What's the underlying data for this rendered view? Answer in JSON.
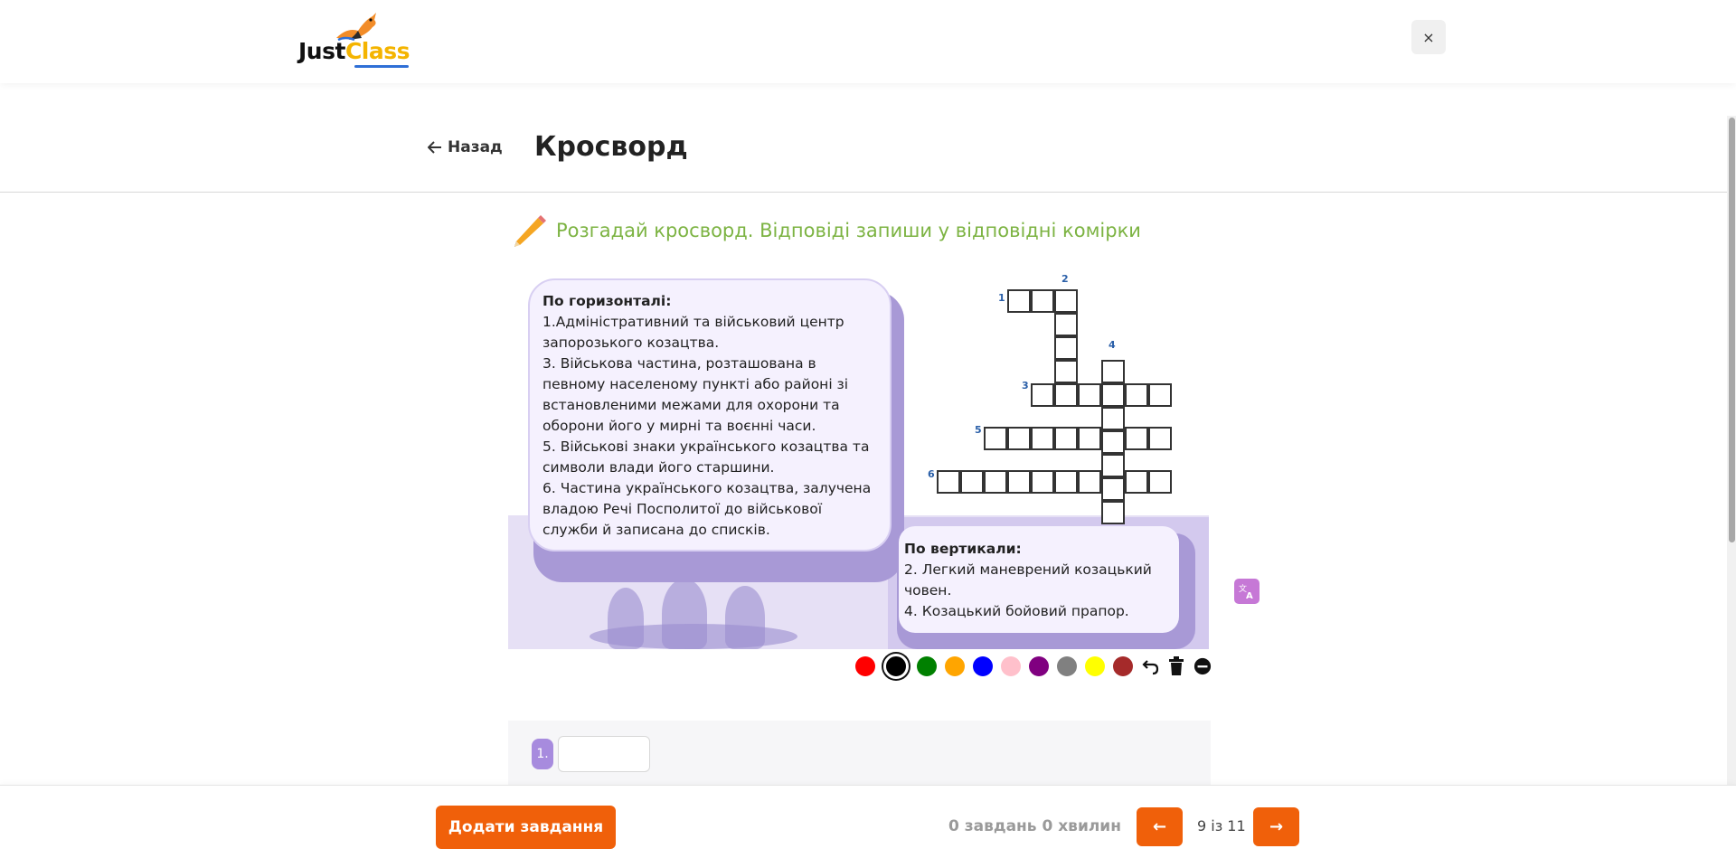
{
  "header": {
    "logo_just": "Just",
    "logo_class": "Class",
    "close_label": "×"
  },
  "page": {
    "back_label": "Назад",
    "title": "Кросворд"
  },
  "task": {
    "instruction": "Розгадай кросворд. Відповіді запиши у відповідні комірки",
    "horizontal_heading": "По горизонталі:",
    "horizontal_clues": [
      "1.Адміністративний та військовий центр запорозького козацтва.",
      "3. Військова частина, розташована в певному населеному пункті або районі зі встановленими межами для охорони та оборони його у мирні та воєнні часи.",
      " 5. Військові знаки українського козацтва та символи влади його старшини.",
      "6. Частина українського козацтва, залучена владою Речі Посполитої до військової служби й записана до списків."
    ],
    "vertical_heading": "По вертикали:",
    "vertical_clues": [
      "2. Легкий маневрений козацький човен.",
      "4. Козацький бойовий прапор."
    ],
    "grid_numbers": [
      "1",
      "2",
      "3",
      "4",
      "5",
      "6"
    ]
  },
  "palette": {
    "colors": [
      "#ff0000",
      "#000000",
      "#008000",
      "#ffa500",
      "#0000ff",
      "#ffc0cb",
      "#800080",
      "#808080",
      "#ffff00",
      "#a52a2a"
    ],
    "selected": "#000000"
  },
  "answer": {
    "badge": "1.",
    "value": ""
  },
  "footer": {
    "add_task_label": "Додати завдання",
    "summary": "0 завдань 0 хвилин",
    "prev_label": "←",
    "next_label": "→",
    "counter": "9 із 11"
  },
  "colors": {
    "accent": "#f0600a",
    "instruction_green": "#7cb342",
    "clue_purple": "#a899d6"
  }
}
